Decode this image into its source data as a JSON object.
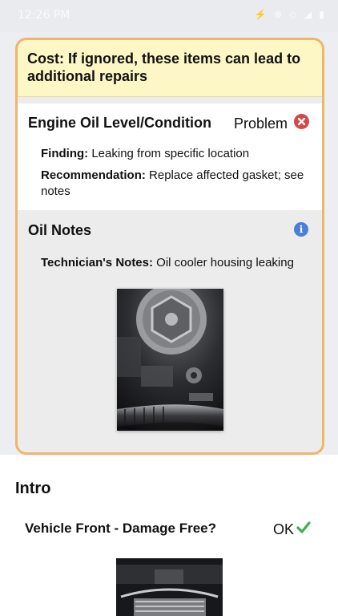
{
  "status_bar": {
    "time": "12:26 PM",
    "indicators": "⚡ ⊕  ◇ ◢ ▮"
  },
  "cost_banner": {
    "text": "Cost: If ignored, these items can lead to additional repairs"
  },
  "inspection_item": {
    "title": "Engine Oil Level/Condition",
    "status": "Problem",
    "status_icon": "error-x-icon",
    "status_color": "#d84646",
    "finding_label": "Finding:",
    "finding_value": "Leaking from specific location",
    "recommendation_label": "Recommendation:",
    "recommendation_value": "Replace affected gasket; see notes"
  },
  "notes": {
    "title": "Oil Notes",
    "icon": "info-icon",
    "tech_label": "Technician's Notes:",
    "tech_value": "Oil cooler housing leaking"
  },
  "intro": {
    "heading": "Intro",
    "item_title": "Vehicle Front - Damage Free?",
    "item_status": "OK",
    "status_icon": "check-icon",
    "status_color": "#38b24a"
  },
  "colors": {
    "card_border": "#f0b46a",
    "banner_bg": "#fdf7c6"
  }
}
